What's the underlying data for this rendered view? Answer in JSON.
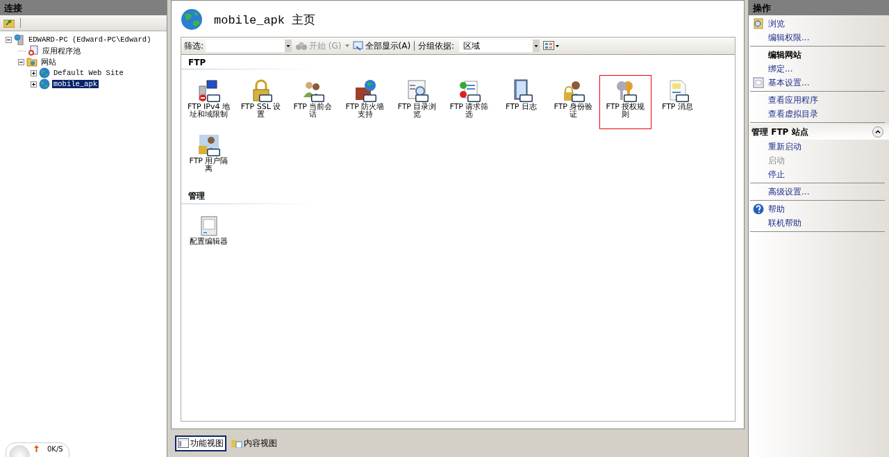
{
  "connections": {
    "title": "连接",
    "tree": [
      {
        "label": "EDWARD-PC (Edward-PC\\Edward)",
        "expanded": true,
        "selected": false,
        "children": [
          {
            "label": "应用程序池",
            "selected": false
          },
          {
            "label": "网站",
            "expanded": true,
            "selected": false,
            "children": [
              {
                "label": "Default Web Site",
                "expanded": false,
                "selected": false
              },
              {
                "label": "mobile_apk",
                "expanded": false,
                "selected": true
              }
            ]
          }
        ]
      }
    ]
  },
  "main": {
    "title": "mobile_apk 主页",
    "toolbar": {
      "filter_label": "筛选:",
      "start": "开始 (G)",
      "show_all": "全部显示(A)",
      "group_label": "分组依据:",
      "group_value": "区域"
    },
    "sections": [
      {
        "title": "FTP",
        "features": [
          {
            "label": "FTP IPv4 地址和域限制",
            "selected": false
          },
          {
            "label": "FTP SSL 设置",
            "selected": false
          },
          {
            "label": "FTP 当前会话",
            "selected": false
          },
          {
            "label": "FTP 防火墙支持",
            "selected": false
          },
          {
            "label": "FTP 目录浏览",
            "selected": false
          },
          {
            "label": "FTP 请求筛选",
            "selected": false
          },
          {
            "label": "FTP 日志",
            "selected": false
          },
          {
            "label": "FTP 身份验证",
            "selected": false
          },
          {
            "label": "FTP 授权规则",
            "selected": true
          },
          {
            "label": "FTP 消息",
            "selected": false
          },
          {
            "label": "FTP 用户隔离",
            "selected": false
          }
        ]
      },
      {
        "title": "管理",
        "features": [
          {
            "label": "配置编辑器",
            "selected": false
          }
        ]
      }
    ],
    "view_tabs": [
      {
        "label": "功能视图",
        "selected": true
      },
      {
        "label": "内容视图",
        "selected": false
      }
    ]
  },
  "actions": {
    "title": "操作",
    "groups": [
      {
        "items": [
          {
            "label": "浏览",
            "kind": "link",
            "disabled": false
          },
          {
            "label": "编辑权限...",
            "kind": "link",
            "disabled": false
          }
        ]
      },
      {
        "items": [
          {
            "label": "编辑网站",
            "kind": "heading"
          },
          {
            "label": "绑定...",
            "kind": "link",
            "disabled": false
          },
          {
            "label": "基本设置...",
            "kind": "link",
            "disabled": false
          }
        ]
      },
      {
        "items": [
          {
            "label": "查看应用程序",
            "kind": "link",
            "disabled": false
          },
          {
            "label": "查看虚拟目录",
            "kind": "link",
            "disabled": false
          }
        ]
      },
      {
        "header": "管理 FTP 站点",
        "expanded": true,
        "items": [
          {
            "label": "重新启动",
            "kind": "link",
            "disabled": false
          },
          {
            "label": "启动",
            "kind": "link",
            "disabled": true
          },
          {
            "label": "停止",
            "kind": "link",
            "disabled": false
          }
        ]
      },
      {
        "items": [
          {
            "label": "高级设置...",
            "kind": "link",
            "disabled": false
          }
        ]
      },
      {
        "items": [
          {
            "label": "帮助",
            "kind": "link",
            "disabled": false
          },
          {
            "label": "联机帮助",
            "kind": "link",
            "disabled": false
          }
        ]
      }
    ]
  },
  "speed_widget": {
    "reading": "0K/S"
  }
}
